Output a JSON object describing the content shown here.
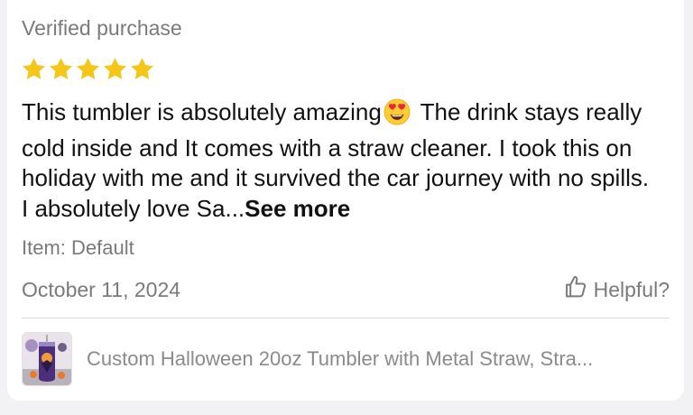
{
  "review": {
    "verified_label": "Verified purchase",
    "rating": 5,
    "rating_max": 5,
    "star_color": "#f5c518",
    "text_before_emoji": "This tumbler is absolutely amazing",
    "emoji": "heart-eyes-emoji",
    "text_after_emoji": " The drink stays really cold inside and It comes with a straw cleaner. I took this on holiday with me and it survived the car journey with no spills. I absolutely love Sa...",
    "see_more_label": "See more",
    "item_variant": "Item: Default",
    "date": "October 11, 2024",
    "helpful_label": "Helpful?"
  },
  "product": {
    "title": "Custom Halloween 20oz Tumbler with Metal Straw, Stra...",
    "thumbnail_icon": "halloween-tumbler-thumbnail"
  }
}
